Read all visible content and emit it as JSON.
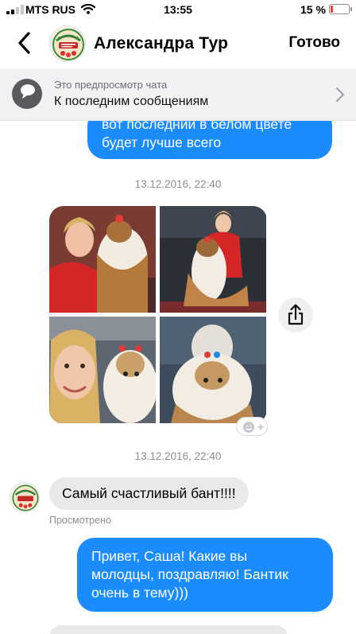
{
  "status_bar": {
    "carrier": "MTS RUS",
    "time": "13:55",
    "battery_percent_label": "15 %",
    "battery_level": 0.15,
    "battery_color": "#ff3b30",
    "icons": [
      "signal-icon",
      "wifi-icon",
      "battery-icon"
    ]
  },
  "header": {
    "contact_name": "Александра Тур",
    "done_label": "Готово",
    "back_icon": "chevron-left-icon"
  },
  "preview_banner": {
    "caption": "Это предпросмотр чата",
    "title": "К последним сообщениям",
    "icon": "chat-bubble-icon",
    "chevron": "chevron-right-icon"
  },
  "messages": {
    "outgoing_top": {
      "text_line1": "вот последний в белом цвете",
      "text_line2": "будет лучше всего"
    },
    "timestamp_1": "13.12.2016, 22:40",
    "photos": [
      "photo-woman-with-dog",
      "photo-dog-on-show-table",
      "photo-woman-and-dog-closeup",
      "photo-dog-portrait"
    ],
    "timestamp_2": "13.12.2016, 22:40",
    "incoming": {
      "text": "Самый счастливый бант!!!!"
    },
    "seen_label": "Просмотрено",
    "outgoing_bottom": {
      "line1": "Привет, Саша! Какие вы",
      "line2": "молодцы, поздравляю! Бантик",
      "line3": "очень в тему)))"
    }
  },
  "colors": {
    "outgoing_bubble": "#1a8cff",
    "incoming_bubble": "#e9e9eb",
    "banner_background": "#f2f2f5",
    "meta_text": "#8e8e93"
  }
}
